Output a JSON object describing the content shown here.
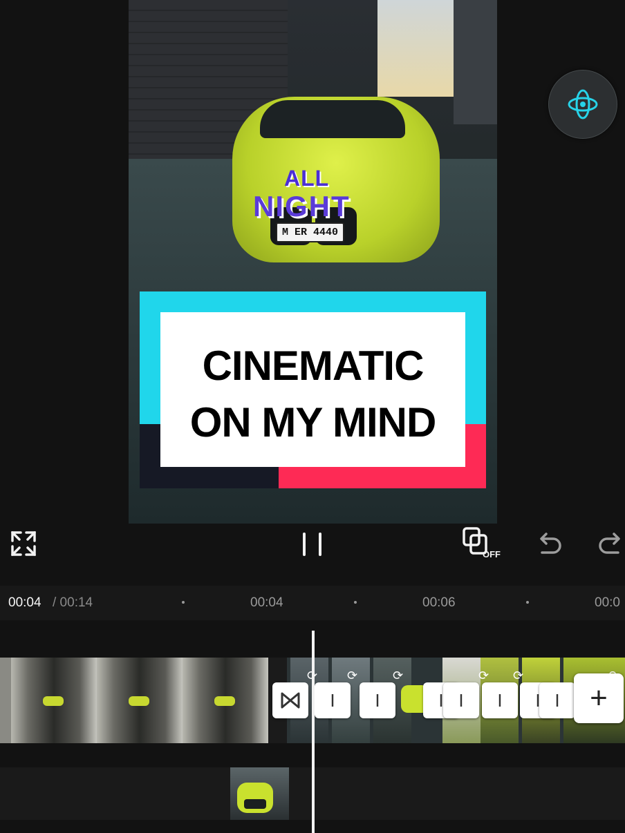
{
  "preview": {
    "logo_line1": "ALL",
    "logo_line2": "NIGHT",
    "plate_text": "M ER 4440",
    "title_line1": "CINEMATIC",
    "title_line2": "ON MY MIND"
  },
  "toolbar": {
    "fullscreen_icon": "fullscreen-icon",
    "pause_icon": "pause-icon",
    "keyframe_toggle_label": "OFF",
    "undo_icon": "undo-icon",
    "redo_icon": "redo-icon"
  },
  "timeline": {
    "current_time": "00:04",
    "total_time": "/ 00:14",
    "ticks": [
      "00:04",
      "00:06",
      "00:0"
    ],
    "add_label": "+"
  },
  "colors": {
    "card_cyan": "#20d6eb",
    "card_red": "#fe2a55",
    "card_dark": "#161925",
    "car_lime": "#c9e12e"
  }
}
